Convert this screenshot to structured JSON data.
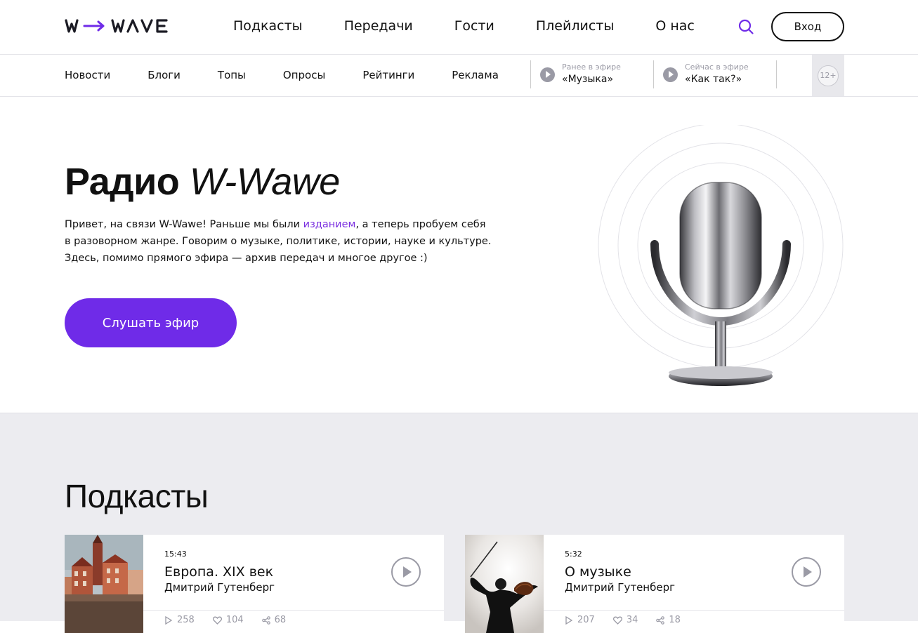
{
  "header": {
    "logo_text": "W→WAVE",
    "nav": [
      "Подкасты",
      "Передачи",
      "Гости",
      "Плейлисты",
      "О нас"
    ],
    "login_label": "Вход"
  },
  "subnav": {
    "links": [
      "Новости",
      "Блоги",
      "Топы",
      "Опросы",
      "Рейтинги",
      "Реклама"
    ],
    "prev_label": "Ранее в эфире",
    "prev_name": "«Музыка»",
    "now_label": "Сейчас в эфире",
    "now_name": "«Как так?»",
    "age": "12+"
  },
  "hero": {
    "title_bold": "Радио",
    "title_italic": "W-Wawe",
    "text_before": "Привет, на связи W-Wawe! Раньше мы были ",
    "text_link": "изданием",
    "text_after": ", а теперь пробуем себя в разоворном жанре. Говорим о музыке, политике, истории, науке и культуре. Здесь, помимо прямого эфира — архив передач и многое другое :)",
    "button": "Слушать эфир"
  },
  "podcasts": {
    "title": "Подкасты",
    "items": [
      {
        "duration": "15:43",
        "title": "Европа. XIX век",
        "author": "Дмитрий Гутенберг",
        "plays": "258",
        "likes": "104",
        "shares": "68"
      },
      {
        "duration": "5:32",
        "title": "О музыке",
        "author": "Дмитрий Гутенберг",
        "plays": "207",
        "likes": "34",
        "shares": "18"
      }
    ]
  },
  "colors": {
    "accent": "#6f2be8",
    "link": "#7b2fe0",
    "muted": "#9a9aa5",
    "section_bg": "#ececf0"
  },
  "icons": [
    "search-icon",
    "play-icon",
    "microphone-illustration",
    "heart-icon",
    "share-icon"
  ]
}
